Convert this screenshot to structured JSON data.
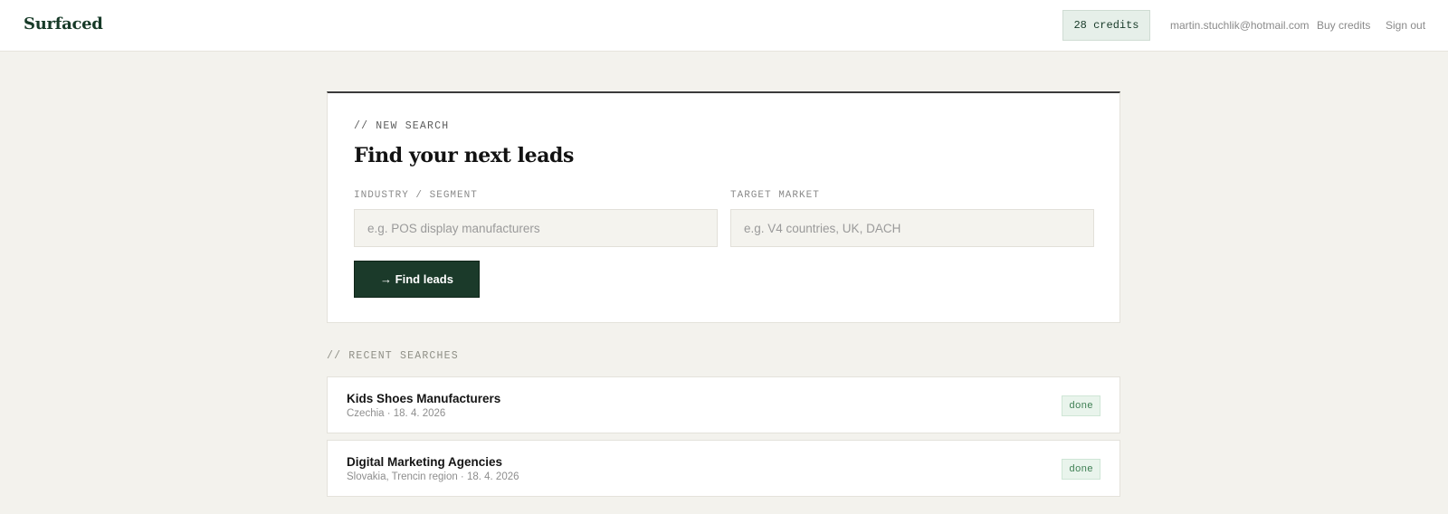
{
  "header": {
    "logo": "Surfaced",
    "credits": "28 credits",
    "email": "martin.stuchlik@hotmail.com",
    "buy_credits": "Buy credits",
    "sign_out": "Sign out"
  },
  "new_search": {
    "eyebrow": "// NEW SEARCH",
    "title": "Find your next leads",
    "industry_label": "INDUSTRY / SEGMENT",
    "industry_placeholder": "e.g. POS display manufacturers",
    "industry_value": "",
    "market_label": "TARGET MARKET",
    "market_placeholder": "e.g. V4 countries, UK, DACH",
    "market_value": "",
    "button_label": "→ Find leads"
  },
  "recent": {
    "eyebrow": "// RECENT SEARCHES",
    "items": [
      {
        "title": "Kids Shoes Manufacturers",
        "subtitle": "Czechia · 18. 4. 2026",
        "status": "done"
      },
      {
        "title": "Digital Marketing Agencies",
        "subtitle": "Slovakia, Trencin region · 18. 4. 2026",
        "status": "done"
      }
    ]
  },
  "colors": {
    "brand_green": "#1b3a2a",
    "status_done": "#3e7f53",
    "background": "#f3f2ed"
  }
}
